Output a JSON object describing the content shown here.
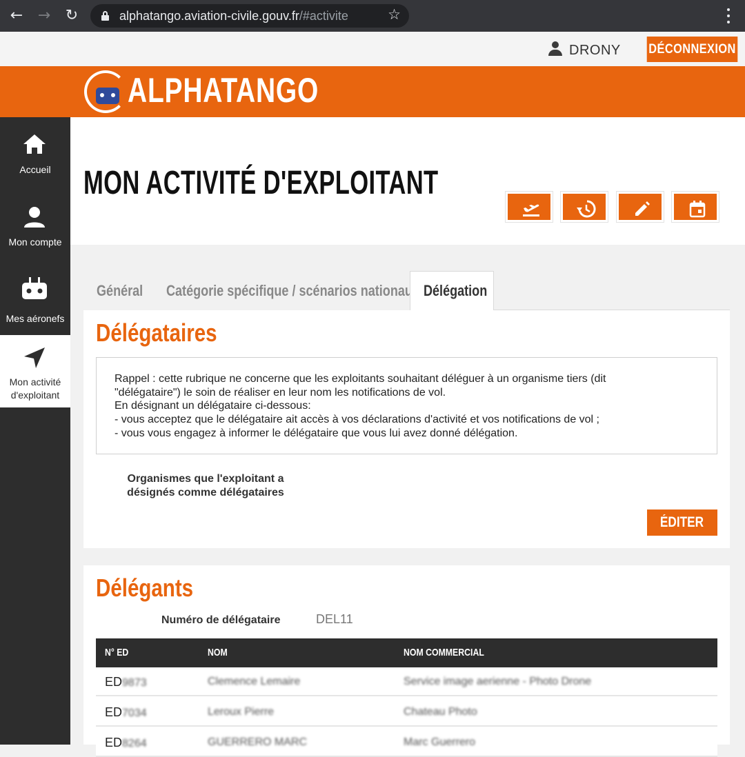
{
  "browser": {
    "url_host": "alphatango.aviation-civile.gouv.fr",
    "url_path": "/#activite"
  },
  "userbar": {
    "username": "DRONY",
    "logout_label": "DÉCONNEXION"
  },
  "brand": {
    "logo_text": "ALPHATANGO"
  },
  "sidebar": {
    "items": [
      {
        "label": "Accueil",
        "icon": "home-icon"
      },
      {
        "label": "Mon compte",
        "icon": "person-icon"
      },
      {
        "label": "Mes aéronefs",
        "icon": "drone-icon"
      },
      {
        "label_line1": "Mon activité",
        "label_line2": "d'exploitant",
        "icon": "navigation-arrow-icon",
        "active": true
      }
    ]
  },
  "page": {
    "title": "MON ACTIVITÉ D'EXPLOITANT",
    "toolbar_icons": [
      "flight-takeoff-icon",
      "history-icon",
      "edit-pencil-icon",
      "calendar-icon"
    ]
  },
  "tabs": [
    {
      "label": "Général"
    },
    {
      "label": "Catégorie spécifique / scénarios nationaux"
    },
    {
      "label": "Délégation",
      "active": true
    }
  ],
  "delegataires": {
    "title": "Délégataires",
    "notice": [
      "Rappel : cette rubrique ne concerne que les exploitants souhaitant déléguer à un organisme tiers (dit",
      "\"délégataire\") le soin de réaliser en leur nom les notifications de vol.",
      "En désignant un délégataire ci-dessous:",
      "- vous acceptez que le délégataire ait accès à vos déclarations d'activité et vos notifications de vol ;",
      "- vous vous engagez à informer le délégataire que vous lui avez donné délégation."
    ],
    "organismes_label_line1": "Organismes que l'exploitant a",
    "organismes_label_line2": "désignés comme délégataires",
    "edit_label": "ÉDITER"
  },
  "delegants": {
    "title": "Délégants",
    "numero_label": "Numéro de délégataire",
    "numero_value": "DEL11",
    "columns": [
      "N° ED",
      "NOM",
      "NOM COMMERCIAL"
    ],
    "rows": [
      {
        "ed": "ED",
        "ed_blur": "9873",
        "nom": "Clemence Lemaire",
        "commercial": "Service image aerienne - Photo Drone"
      },
      {
        "ed": "ED",
        "ed_blur": "7034",
        "nom": "Leroux Pierre",
        "commercial": "Chateau Photo"
      },
      {
        "ed": "ED",
        "ed_blur": "8264",
        "nom": "GUERRERO MARC",
        "commercial": "Marc Guerrero"
      }
    ]
  },
  "colors": {
    "accent": "#e8650f",
    "dark": "#2d2d2d"
  }
}
